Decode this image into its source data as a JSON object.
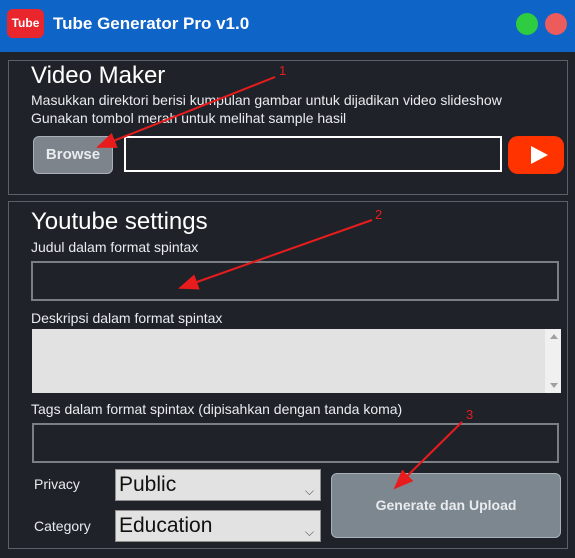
{
  "window": {
    "logo_text": "Tube",
    "title": "Tube Generator Pro v1.0",
    "colors": {
      "titlebar": "#0f64c8",
      "background": "#1f2329",
      "close": "#ec5c5c",
      "maximize": "#2ecc40"
    }
  },
  "video_maker": {
    "heading": "Video Maker",
    "line1": "Masukkan direktori berisi kumpulan gambar untuk dijadikan video slideshow",
    "line2": "Gunakan tombol merah untuk melihat sample hasil",
    "browse_label": "Browse",
    "directory_value": "",
    "sample_icon": "play-icon"
  },
  "youtube_settings": {
    "heading": "Youtube settings",
    "judul_label": "Judul dalam format spintax",
    "judul_value": "",
    "deskripsi_label": "Deskripsi dalam format spintax",
    "deskripsi_value": "",
    "tags_label": "Tags dalam format spintax (dipisahkan dengan tanda koma)",
    "tags_value": "",
    "privacy_label": "Privacy",
    "privacy_selected": "Public",
    "category_label": "Category",
    "category_selected": "Education",
    "generate_label": "Generate dan Upload"
  },
  "annotations": {
    "n1": "1",
    "n2": "2",
    "n3": "3"
  }
}
